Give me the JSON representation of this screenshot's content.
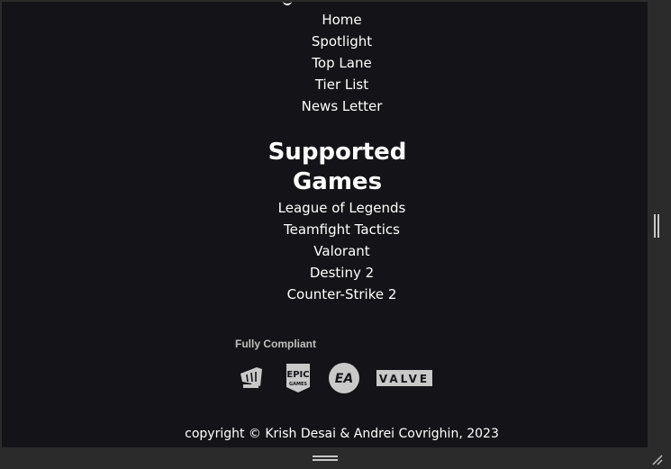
{
  "nav": {
    "items": [
      "Home",
      "Spotlight",
      "Top Lane",
      "Tier List",
      "News Letter"
    ]
  },
  "supported_games": {
    "heading": "Supported Games",
    "items": [
      "League of Legends",
      "Teamfight Tactics",
      "Valorant",
      "Destiny 2",
      "Counter-Strike 2"
    ]
  },
  "compliance": {
    "label": "Fully Compliant",
    "logos": [
      {
        "icon": "riot-games-logo-icon"
      },
      {
        "icon": "epic-games-logo-icon",
        "text_top": "EPIC",
        "text_bottom": "GAMES"
      },
      {
        "icon": "ea-logo-icon",
        "text": "EA"
      },
      {
        "icon": "valve-logo-icon",
        "text": "VALVE"
      }
    ]
  },
  "footer": {
    "copyright": "copyright © Krish Desai & Andrei Covrighin, 2023"
  },
  "colors": {
    "background": "#141418",
    "frame": "#2b2b2b",
    "text": "#ffffff",
    "muted_text": "#bfbfbf",
    "logo": "#c9c9c9"
  }
}
